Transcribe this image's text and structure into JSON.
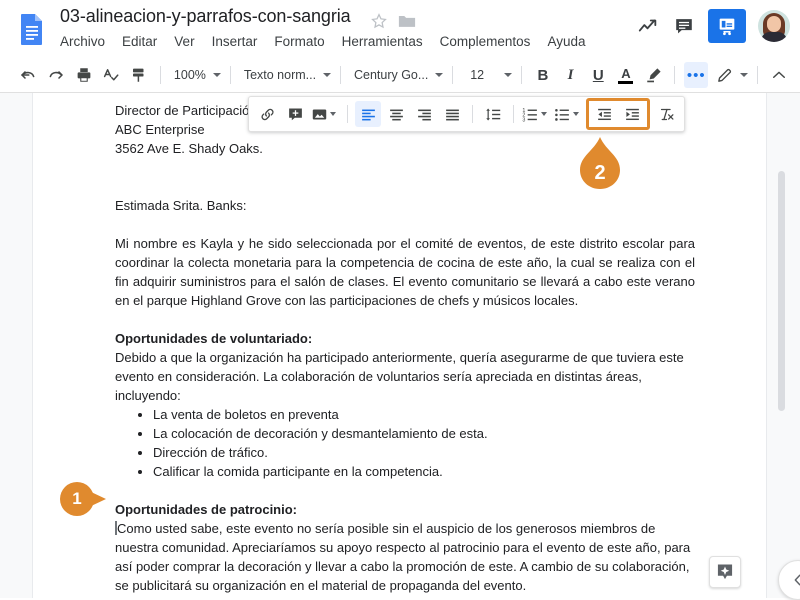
{
  "app": {
    "name": "Google Docs",
    "logo_icon": "docs-file-icon",
    "accent_blue": "#1a73e8",
    "callout_orange": "#e08a2e"
  },
  "header": {
    "doc_title": "03-alineacion-y-parrafos-con-sangria",
    "star_icon": "star-outline-icon",
    "folder_icon": "folder-icon",
    "menus": [
      "Archivo",
      "Editar",
      "Ver",
      "Insertar",
      "Formato",
      "Herramientas",
      "Complementos",
      "Ayuda"
    ],
    "right_icons": [
      {
        "name": "activity-dashboard-icon",
        "glyph": "trend-arrow"
      },
      {
        "name": "comment-history-icon",
        "glyph": "comment-box"
      }
    ],
    "share_button": {
      "name": "present-share-button",
      "icon": "slides-present-icon"
    },
    "avatar": {
      "name": "user-avatar",
      "alt": "Cuenta de usuario"
    }
  },
  "toolbar": {
    "undo_label": "Deshacer",
    "redo_label": "Rehacer",
    "print_label": "Imprimir",
    "spellcheck_label": "Ortografía",
    "paint_format_label": "Pintar formato",
    "zoom_value": "100%",
    "style_value": "Texto norm...",
    "font_value": "Century Go...",
    "size_value": "12",
    "bold_label": "B",
    "italic_label": "I",
    "underline_label": "U",
    "text_color_label": "A",
    "highlight_label": "Color de resaltado",
    "more_label": "Más",
    "edit_mode_label": "Modo de edición",
    "collapse_toolbar_label": "Ocultar menús"
  },
  "float_toolbar": {
    "items": [
      {
        "name": "insert-link-button",
        "label": "Insertar vínculo",
        "icon": "link-icon",
        "active": false
      },
      {
        "name": "add-comment-button",
        "label": "Añadir comentario",
        "icon": "comment-plus-icon",
        "active": false
      },
      {
        "name": "insert-image-button",
        "label": "Insertar imagen",
        "icon": "image-icon",
        "active": false
      },
      {
        "name": "align-left-button",
        "label": "Alinear a la izquierda",
        "icon": "align-left-icon",
        "active": true
      },
      {
        "name": "align-center-button",
        "label": "Centrar",
        "icon": "align-center-icon",
        "active": false
      },
      {
        "name": "align-right-button",
        "label": "Alinear a la derecha",
        "icon": "align-right-icon",
        "active": false
      },
      {
        "name": "align-justify-button",
        "label": "Justificar",
        "icon": "align-justify-icon",
        "active": false
      },
      {
        "name": "line-spacing-button",
        "label": "Interlineado",
        "icon": "line-spacing-icon",
        "active": false
      },
      {
        "name": "numbered-list-button",
        "label": "Lista numerada",
        "icon": "numbered-list-icon",
        "active": false
      },
      {
        "name": "bulleted-list-button",
        "label": "Lista con viñetas",
        "icon": "bulleted-list-icon",
        "active": false
      },
      {
        "name": "decrease-indent-button",
        "label": "Reducir sangría",
        "icon": "decrease-indent-icon",
        "active": false
      },
      {
        "name": "increase-indent-button",
        "label": "Aumentar sangría",
        "icon": "increase-indent-icon",
        "active": false
      },
      {
        "name": "clear-formatting-button",
        "label": "Borrar formato",
        "icon": "clear-format-icon",
        "active": false
      }
    ],
    "highlighted_group": "sangria"
  },
  "callouts": [
    {
      "name": "callout-badge-1",
      "number": "1",
      "shape": "circle-pointer-right"
    },
    {
      "name": "callout-badge-2",
      "number": "2",
      "shape": "teardrop-pointer-up"
    }
  ],
  "document": {
    "address": {
      "line1": "Director de Participación",
      "line2": "ABC Enterprise",
      "line3": "3562 Ave E. Shady Oaks."
    },
    "salutation": "Estimada Srita. Banks:",
    "paragraph_1": "Mi nombre es Kayla y he sido seleccionada por el comité de eventos, de este distrito escolar para coordinar la colecta monetaria para la competencia de cocina de este año, la cual se realiza con el fin adquirir suministros para el salón de clases. El evento comunitario se llevará a cabo este verano en el parque Highland Grove con las participaciones de chefs y músicos locales.",
    "heading_1": "Oportunidades de voluntariado:",
    "paragraph_2": "Debido a que la organización ha participado anteriormente, quería asegurarme de que tuviera este evento en consideración. La colaboración de voluntarios sería apreciada en distintas áreas, incluyendo:",
    "bullets": [
      "La venta de boletos en preventa",
      "La colocación de decoración y desmantelamiento de esta.",
      "Dirección de tráfico.",
      "Calificar la comida participante en la competencia."
    ],
    "heading_2": "Oportunidades de patrocinio:",
    "paragraph_3": "Como usted sabe, este evento no sería posible sin el auspicio de los generosos miembros de nuestra comunidad. Apreciaríamos su apoyo respecto al patrocinio para el evento de este año, para así poder comprar la decoración y llevar a cabo la promoción de este. A cambio de su colaboración, se publicitará su organización en el material de propaganda del evento."
  },
  "bottom": {
    "explore_button_label": "Explorar",
    "explore_icon": "explore-star-icon",
    "collapse_panel_label": "Ocultar panel",
    "collapse_icon": "chevron-left-icon"
  },
  "scrollbar": {
    "name": "vertical-scrollbar",
    "orientation": "vertical"
  }
}
